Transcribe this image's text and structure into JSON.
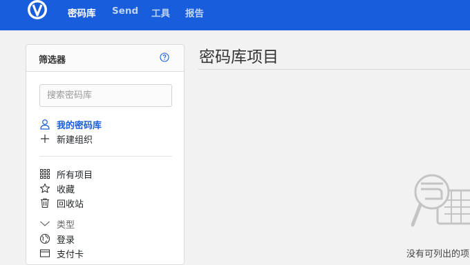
{
  "nav": {
    "logo": "bitwarden-shield-logo",
    "items": [
      {
        "label": "密码库",
        "active": true
      },
      {
        "label": "Send",
        "active": false
      },
      {
        "label": "工具",
        "active": false
      },
      {
        "label": "报告",
        "active": false
      }
    ]
  },
  "filter": {
    "title": "筛选器",
    "help_icon": "question-circle-icon",
    "search_placeholder": "搜索密码库",
    "my_vault": "我的密码库",
    "new_org": "新建组织",
    "all_items": "所有项目",
    "favorites": "收藏",
    "trash": "回收站",
    "types_header": "类型",
    "login": "登录",
    "card_partial": "支付卡"
  },
  "main": {
    "title": "密码库项目",
    "empty_text": "没有可列出的项目。"
  },
  "colors": {
    "brand": "#175ddc",
    "background": "#f2f2f3"
  }
}
